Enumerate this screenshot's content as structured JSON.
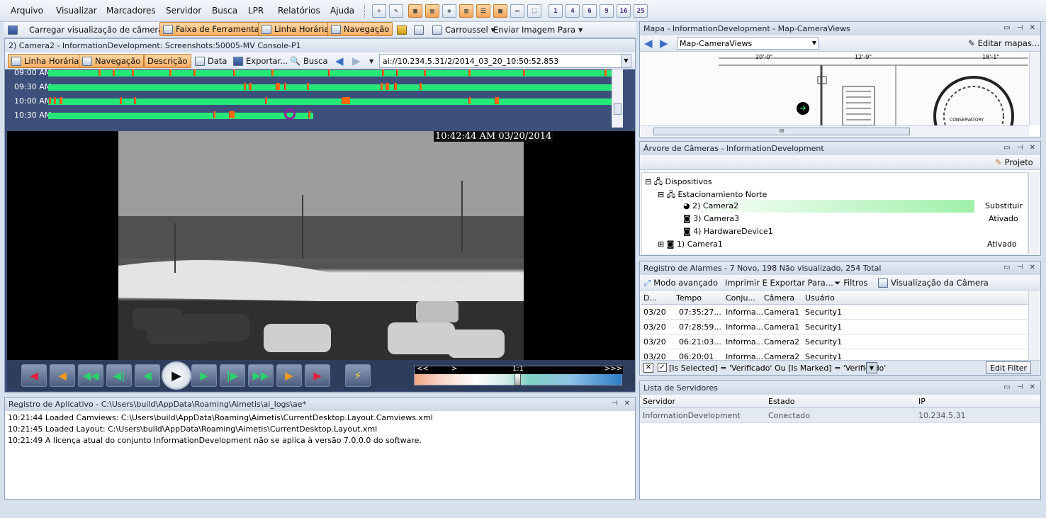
{
  "menu": {
    "items": [
      "Arquivo",
      "Visualizar",
      "Marcadores",
      "Servidor",
      "Busca",
      "LPR",
      "Relatórios",
      "Ajuda"
    ]
  },
  "quick_toolbar": {
    "layout_numbers": [
      "1",
      "4",
      "6",
      "9",
      "16",
      "25"
    ]
  },
  "main_toolbar": {
    "load_view": "Carregar visualização de câmera",
    "toolbar_strip": "Faixa de Ferramentas",
    "timeline": "Linha Horária",
    "navigation": "Navegação",
    "carousel": "Carroussel",
    "send_image": "Enviar Imagem Para"
  },
  "camera_panel": {
    "title": "2) Camera2 - InformationDevelopment: Screenshots:50005-MV Console-P1",
    "toolbar": {
      "timeline": "Linha Horária",
      "navigation": "Navegação",
      "description": "Descrição",
      "date": "Data",
      "export": "Exportar...",
      "search": "Busca",
      "address": "ai://10.234.5.31/2/2014_03_20_10:50:52.853"
    },
    "timeline_rows": [
      "09:00 AM",
      "09:30 AM",
      "10:00 AM",
      "10:30 AM"
    ],
    "video_timestamp": "10:42:44 AM 03/20/2014",
    "speed": {
      "slow": "<<",
      "normal": ">",
      "ratio": "1:1",
      "fast": ">>>"
    }
  },
  "app_log": {
    "title": "Registro de Aplicativo - C:\\Users\\build\\AppData\\Roaming\\Aimetis\\ai_logs\\ae*",
    "lines": [
      "10:21:44 Loaded Camviews: C:\\Users\\build\\AppData\\Roaming\\Aimetis\\CurrentDesktop.Layout.Camviews.xml",
      "10:21:45 Loaded Layout: C:\\Users\\build\\AppData\\Roaming\\Aimetis\\CurrentDesktop.Layout.xml",
      "10:21:49 A licença atual do conjunto InformationDevelopment não se aplica à versão 7.0.0.0 do software."
    ]
  },
  "map_panel": {
    "title": "Mapa - InformationDevelopment - Map-CameraViews",
    "selected_map": "Map-CameraViews",
    "edit_label": "Editar mapas...",
    "dimension_labels": [
      "20'-0\"",
      "12'-9\"",
      "18'-1\""
    ],
    "room_label": "CONSERVATORY",
    "scroll_grip": "III"
  },
  "camera_tree": {
    "title": "Árvore de Câmeras - InformationDevelopment",
    "project_label": "Projeto",
    "nodes": [
      {
        "label": "Dispositivos",
        "status": ""
      },
      {
        "label": "Estacionamiento Norte",
        "status": ""
      },
      {
        "label": "2) Camera2",
        "status": "Substituir"
      },
      {
        "label": "3) Camera3",
        "status": "Ativado"
      },
      {
        "label": "4) HardwareDevice1",
        "status": ""
      },
      {
        "label": "1) Camera1",
        "status": "Ativado"
      }
    ]
  },
  "alarm_log": {
    "title": "Registro de Alarmes - 7 Novo, 198 Não visualizado, 254 Total",
    "toolbar": {
      "advanced": "Modo avançado",
      "print": "Imprimir E Exportar Para...",
      "filters": "Filtros",
      "camera_view": "Visualização da Câmera"
    },
    "columns": [
      "D...",
      "Tempo",
      "Conju...",
      "Câmera",
      "Usuário"
    ],
    "rows": [
      [
        "03/20",
        "07:35:27...",
        "Informa...",
        "Camera1",
        "Security1"
      ],
      [
        "03/20",
        "07:28:59...",
        "Informa...",
        "Camera1",
        "Security1"
      ],
      [
        "03/20",
        "06:21:03...",
        "Informa...",
        "Camera2",
        "Security1"
      ],
      [
        "03/20",
        "06:20:01",
        "Informa...",
        "Camera2",
        "Security1"
      ]
    ],
    "filter": {
      "text": "[Is Selected] = 'Verificado' Ou [Is Marked] = 'Verificado'",
      "edit_label": "Edit Filter"
    }
  },
  "servers": {
    "title": "Lista de Servidores",
    "columns": [
      "Servidor",
      "Estado",
      "IP"
    ],
    "rows": [
      [
        "InformationDevelopment",
        "Conectado",
        "10.234.5.31"
      ]
    ]
  },
  "colors": {
    "accent": "#f6ad62",
    "timeline_bar": "#26e878",
    "timeline_mark": "#ff6a00",
    "timeline_bg": "#3d4f7b"
  }
}
